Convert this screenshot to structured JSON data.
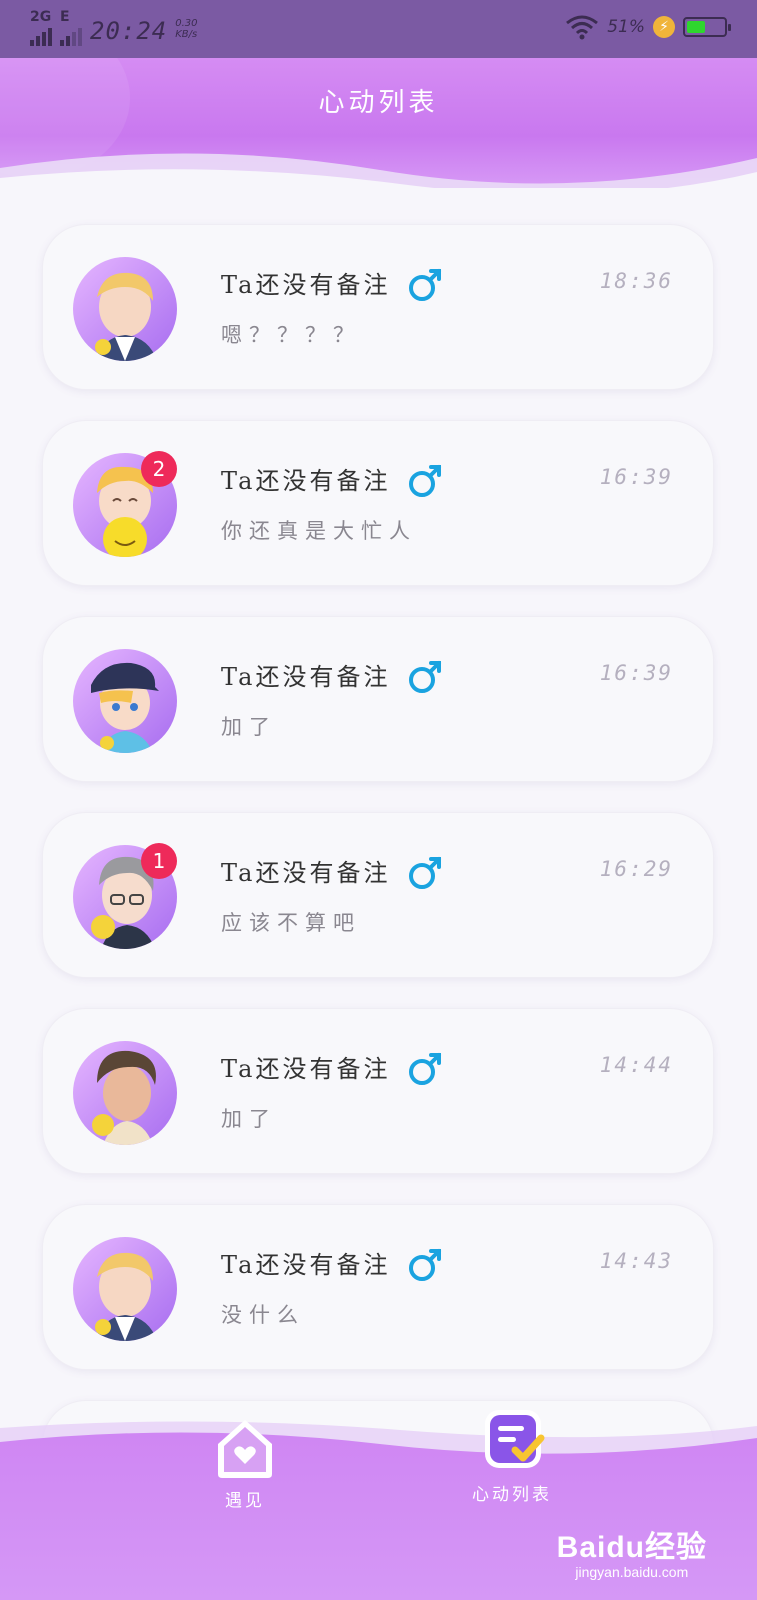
{
  "status_bar": {
    "network": "2G",
    "network2": "E",
    "time": "20:24",
    "speed_value": "0.30",
    "speed_unit": "KB/s",
    "battery_percent": "51%",
    "battery_level": 0.51
  },
  "header": {
    "title": "心动列表"
  },
  "chats": [
    {
      "name": "Ta还没有备注",
      "time": "18:36",
      "message": "嗯？？？？",
      "badge": ""
    },
    {
      "name": "Ta还没有备注",
      "time": "16:39",
      "message": "你还真是大忙人",
      "badge": "2"
    },
    {
      "name": "Ta还没有备注",
      "time": "16:39",
      "message": "加了",
      "badge": ""
    },
    {
      "name": "Ta还没有备注",
      "time": "16:29",
      "message": "应该不算吧",
      "badge": "1"
    },
    {
      "name": "Ta还没有备注",
      "time": "14:44",
      "message": "加了",
      "badge": ""
    },
    {
      "name": "Ta还没有备注",
      "time": "14:43",
      "message": "没什么",
      "badge": ""
    }
  ],
  "bottom_nav": {
    "items": [
      {
        "label": "遇见",
        "icon": "house-heart-icon"
      },
      {
        "label": "心动列表",
        "icon": "checklist-icon"
      }
    ]
  },
  "watermark": {
    "brand": "Baidu经验",
    "url": "jingyan.baidu.com"
  },
  "colors": {
    "accent": "#c978ef",
    "male_icon": "#1aa3e0",
    "badge": "#ee2a5a"
  }
}
